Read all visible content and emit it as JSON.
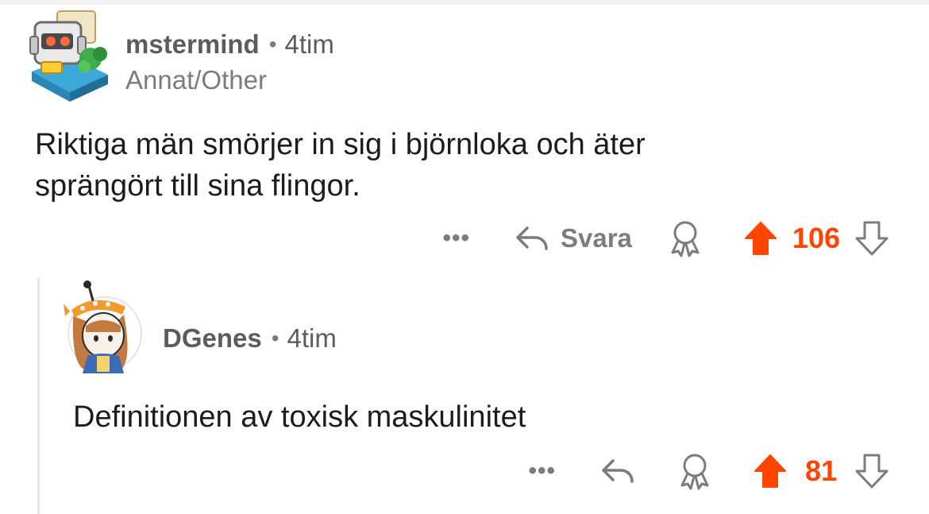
{
  "comments": [
    {
      "author": "mstermind",
      "separator": "•",
      "time": "4tim",
      "flair": "Annat/Other",
      "body_lines": [
        "Riktiga män smörjer in sig i björnloka och äter",
        "sprängört till sina flingor."
      ],
      "more_label": "•••",
      "reply_label": "Svara",
      "score": "106"
    },
    {
      "author": "DGenes",
      "separator": "•",
      "time": "4tim",
      "body": "Definitionen av toxisk maskulinitet",
      "more_label": "•••",
      "score": "81"
    }
  ],
  "icons": {
    "reply": "reply-arrow-icon",
    "award": "award-icon",
    "upvote": "upvote-arrow-icon",
    "downvote": "downvote-arrow-icon"
  },
  "colors": {
    "accent": "#ff4500",
    "meta_text": "#7c7c7c",
    "username": "#5c5c5c",
    "body_text": "#1c1c1c",
    "thread_line": "#e6e6e6"
  }
}
